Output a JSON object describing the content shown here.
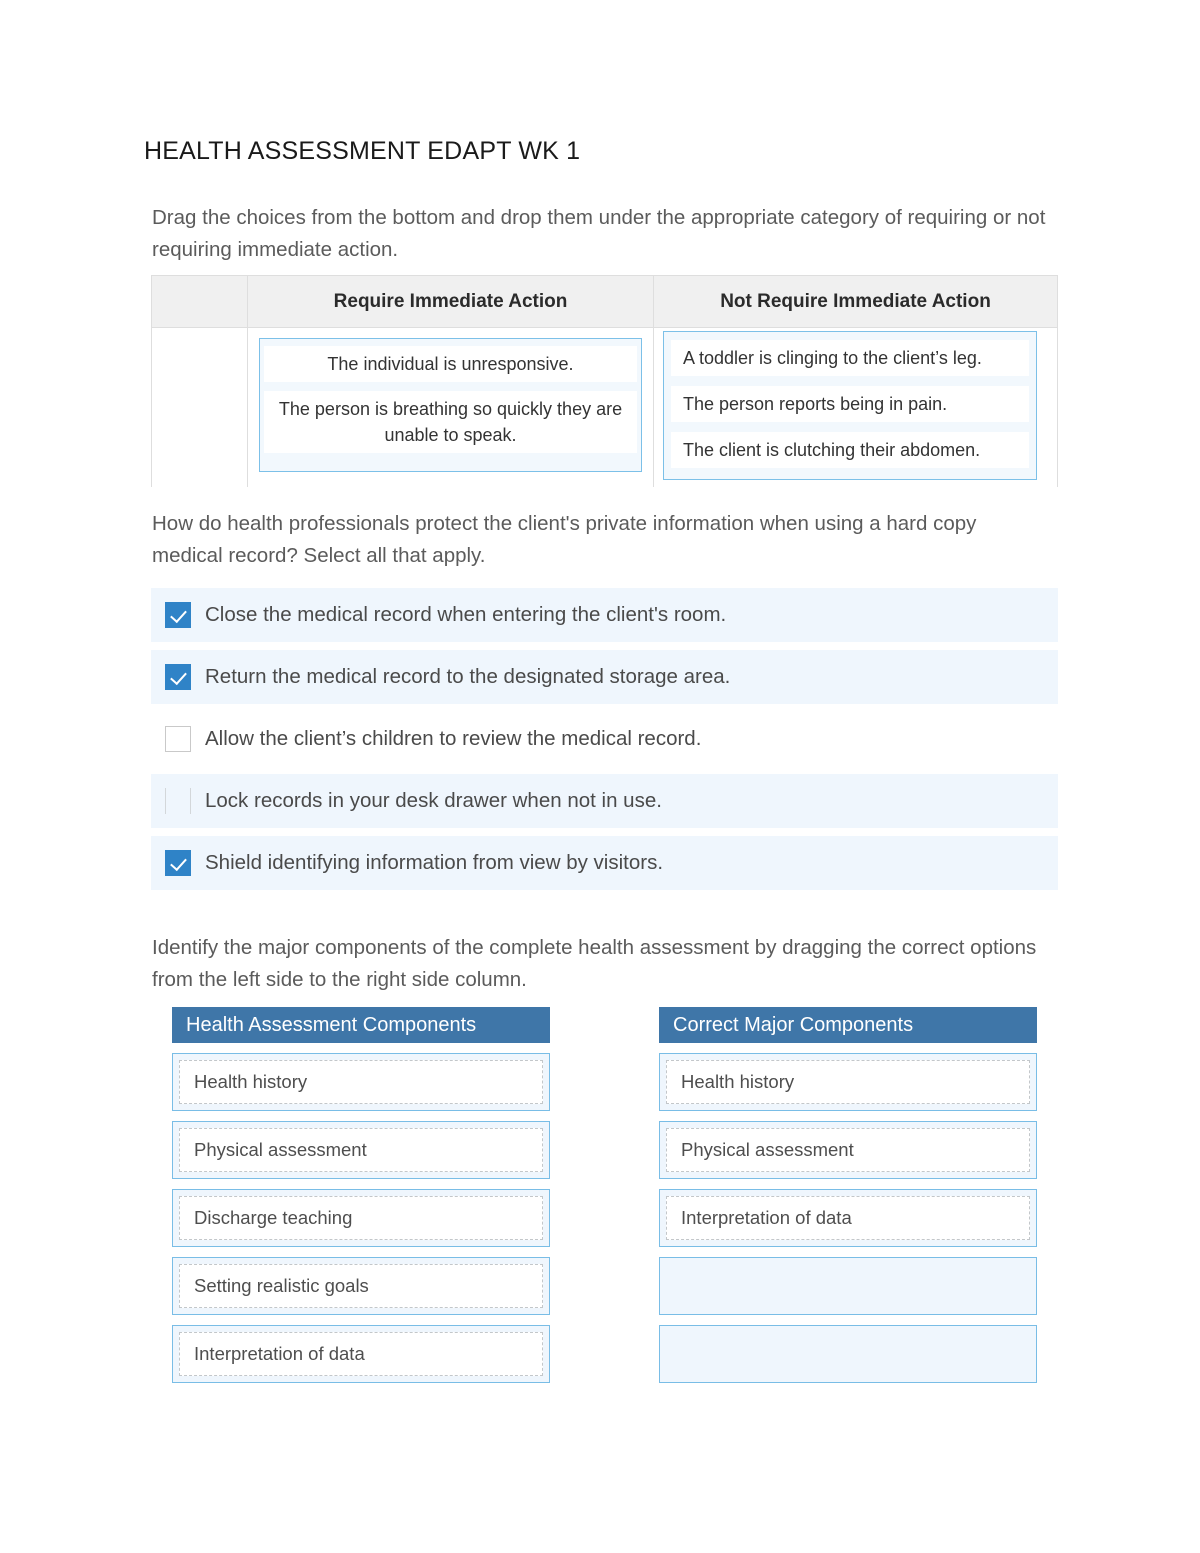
{
  "document": {
    "title": "HEALTH ASSESSMENT EDAPT WK 1"
  },
  "colors": {
    "header_blue": "#3f76a8",
    "checkbox_blue": "#2f83c7",
    "dropzone_border": "#79bde6",
    "dropzone_fill": "#eff6fd",
    "row_shade": "#eff6fd",
    "table_header_gray": "#f0f0f0"
  },
  "q1": {
    "prompt": "Drag the choices from the bottom and drop them under the appropriate category of requiring or not requiring immediate action.",
    "headers": [
      "",
      "Require Immediate Action",
      "Not Require Immediate Action"
    ],
    "require_immediate_action": [
      "The individual is unresponsive.",
      "The person is breathing so quickly they are unable to speak."
    ],
    "not_require_immediate_action": [
      "A toddler is clinging to the client’s leg.",
      "The person reports being in pain.",
      "The client is clutching their abdomen."
    ]
  },
  "q2": {
    "prompt": "How do health professionals protect the client's private information when using a hard copy medical record? Select all that apply.",
    "options": [
      {
        "label": "Close the medical record when entering the client's room.",
        "checked": true,
        "box_state": "checked",
        "row_shaded": true
      },
      {
        "label": "Return the medical record to the designated storage area.",
        "checked": true,
        "box_state": "checked",
        "row_shaded": true
      },
      {
        "label": "Allow the client’s children to review the medical record.",
        "checked": false,
        "box_state": "unchecked",
        "row_shaded": false
      },
      {
        "label": "Lock records in your desk drawer when not in use.",
        "checked": false,
        "box_state": "faint",
        "row_shaded": true
      },
      {
        "label": "Shield identifying information from view by visitors.",
        "checked": true,
        "box_state": "checked",
        "row_shaded": true
      }
    ]
  },
  "q3": {
    "prompt": "Identify the major components of the complete health assessment by dragging the correct options from the left side to the right side column.",
    "left_header": "Health Assessment Components",
    "right_header": "Correct Major Components",
    "left_items": [
      "Health history",
      "Physical assessment",
      "Discharge teaching",
      "Setting realistic goals",
      "Interpretation of data"
    ],
    "right_items": [
      "Health history",
      "Physical assessment",
      "Interpretation of data",
      "",
      ""
    ]
  }
}
